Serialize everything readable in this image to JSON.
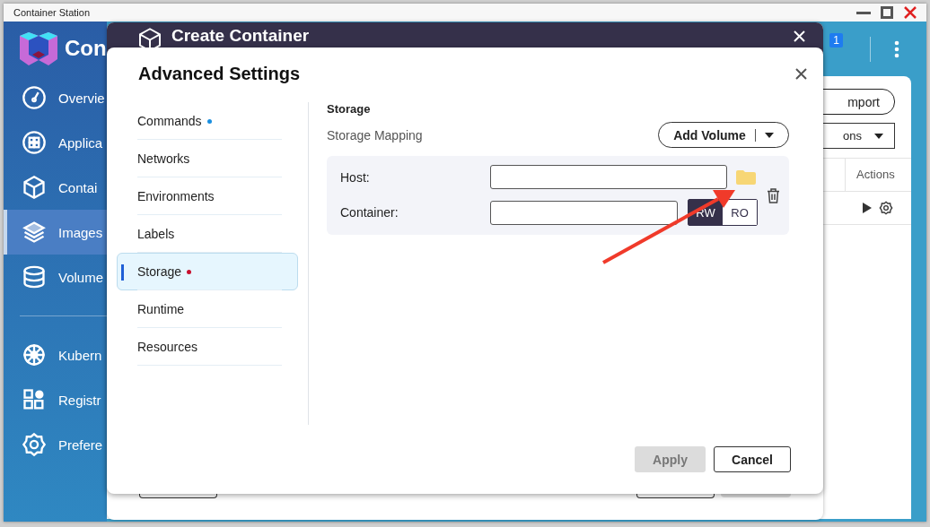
{
  "window": {
    "title": "Container Station"
  },
  "sidebar": {
    "app_name": "Con",
    "groups": [
      {
        "items": [
          {
            "label": "Overvie",
            "selected": false
          },
          {
            "label": "Applica",
            "selected": false
          },
          {
            "label": "Contai",
            "selected": false
          },
          {
            "label": "Images",
            "selected": true
          },
          {
            "label": "Volume",
            "selected": false
          }
        ]
      },
      {
        "items": [
          {
            "label": "Kubern",
            "selected": false
          },
          {
            "label": "Registr",
            "selected": false
          },
          {
            "label": "Prefere",
            "selected": false
          }
        ]
      }
    ]
  },
  "header": {
    "notification_count": "1"
  },
  "background_panel": {
    "import_button": "mport",
    "filter_dropdown": "ons",
    "columns": [
      "Actions"
    ]
  },
  "create_dialog": {
    "title": "Create Container"
  },
  "advanced_dialog": {
    "title": "Advanced Settings",
    "nav": [
      {
        "label": "Commands",
        "selected": false,
        "color": "#1a8fe0"
      },
      {
        "label": "Networks",
        "selected": false
      },
      {
        "label": "Environments",
        "selected": false
      },
      {
        "label": "Labels",
        "selected": false
      },
      {
        "label": "Storage",
        "selected": true,
        "color": "#c8102e"
      },
      {
        "label": "Runtime",
        "selected": false
      },
      {
        "label": "Resources",
        "selected": false
      }
    ],
    "section_title": "Storage",
    "mapping_label": "Storage Mapping",
    "add_button": "Add Volume",
    "mappings": [
      {
        "host_label": "Host:",
        "container_label": "Container:",
        "modes": [
          {
            "label": "RW",
            "selected": true
          },
          {
            "label": "RO",
            "selected": false
          }
        ]
      }
    ],
    "apply": {
      "label": "Apply",
      "disabled": true
    },
    "cancel": {
      "label": "Cancel"
    }
  }
}
